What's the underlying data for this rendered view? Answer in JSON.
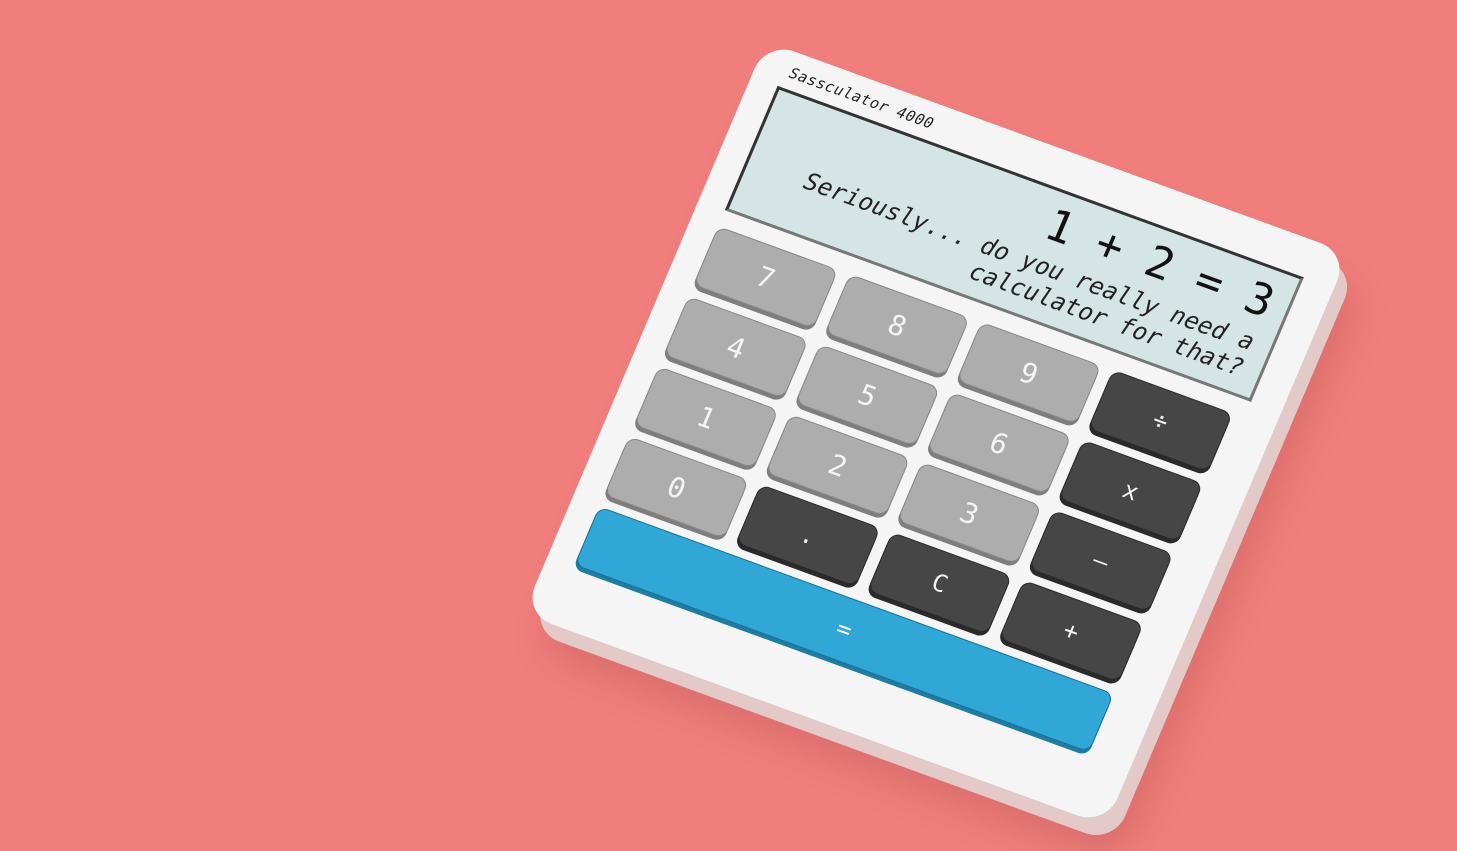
{
  "colors": {
    "background": "#f07e7c",
    "body": "#f5f5f5",
    "screen": "#d5e4e4",
    "number_key": "#adadad",
    "operator_key": "#464646",
    "equals_key": "#30a7d6"
  },
  "calculator": {
    "brand": "Sassculator 4000"
  },
  "display": {
    "expression": "1 + 2 = 3",
    "message": "Seriously... do you really need a calculator for that?"
  },
  "keys": {
    "k7": "7",
    "k8": "8",
    "k9": "9",
    "k4": "4",
    "k5": "5",
    "k6": "6",
    "k1": "1",
    "k2": "2",
    "k3": "3",
    "k0": "0",
    "dot": ".",
    "clear": "C",
    "divide": "÷",
    "multiply": "x",
    "minus": "–",
    "plus": "+",
    "equals": "="
  }
}
